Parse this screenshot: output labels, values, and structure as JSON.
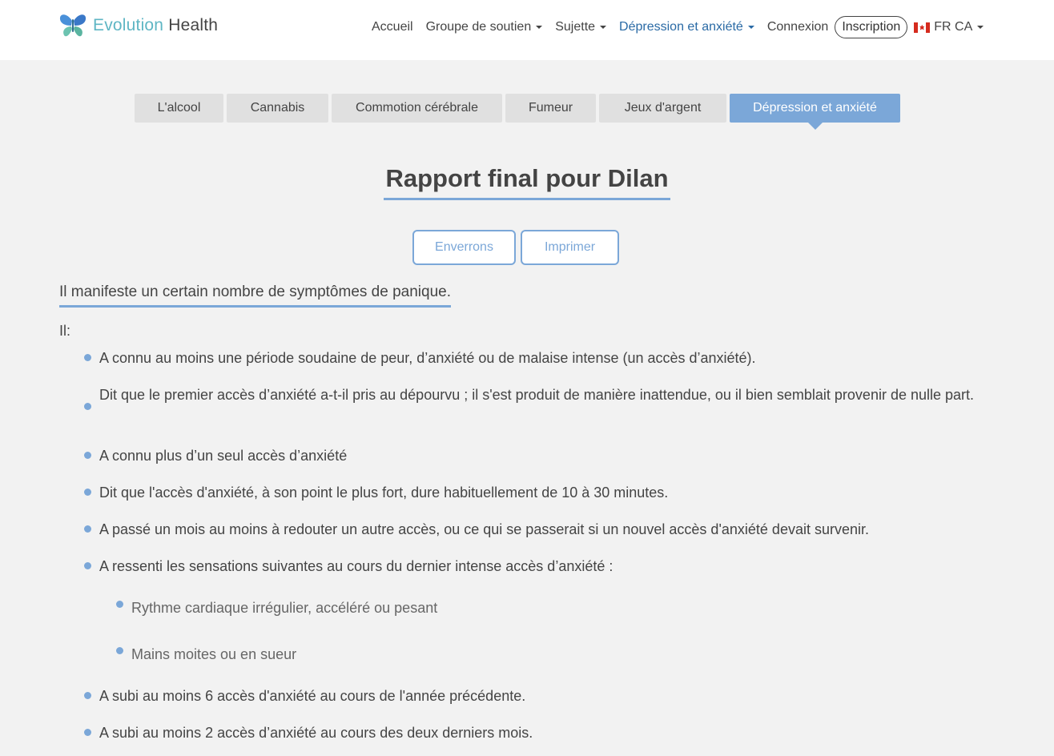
{
  "brand": {
    "name_part1": "Evolution",
    "name_part2": " Health"
  },
  "nav": {
    "home": "Accueil",
    "support": "Groupe de soutien",
    "subject": "Sujette",
    "depression": "Dépression et anxiété",
    "login": "Connexion",
    "signup": "Inscription",
    "lang": "FR CA"
  },
  "tabs": [
    {
      "label": "L'alcool"
    },
    {
      "label": "Cannabis"
    },
    {
      "label": "Commotion cérébrale"
    },
    {
      "label": "Fumeur"
    },
    {
      "label": "Jeux d'argent"
    },
    {
      "label": "Dépression et anxiété"
    }
  ],
  "report": {
    "title": "Rapport final pour Dilan",
    "send_label": "Enverrons",
    "print_label": "Imprimer",
    "summary": "Il manifeste un certain nombre de symptômes de panique.",
    "intro": "Il:",
    "items": [
      "A connu au moins une période soudaine de peur, d’anxiété ou de malaise intense (un accès d’anxiété).",
      "Dit que le premier accès d’anxiété a-t-il pris au dépourvu ; il s'est produit de manière inattendue, ou il bien semblait provenir de nulle part.",
      "A connu plus d’un seul accès d’anxiété",
      "Dit que l'accès d'anxiété, à son point le plus fort, dure habituellement de 10 à 30 minutes.",
      "A passé un mois au moins à redouter un autre accès, ou ce qui se passerait si un nouvel accès d'anxiété devait survenir.",
      "A ressenti les sensations suivantes au cours du dernier intense accès d’anxiété :",
      "A subi au moins 6 accès d'anxiété au cours de l'année précédente.",
      "A subi au moins 2 accès d’anxiété au cours des deux derniers mois."
    ],
    "subitems": [
      "Rythme cardiaque irrégulier, accéléré ou pesant",
      "Mains moites ou en sueur"
    ]
  },
  "colors": {
    "accent": "#7ba7d8",
    "link": "#2a6aa5",
    "brand": "#5fb6c4"
  }
}
